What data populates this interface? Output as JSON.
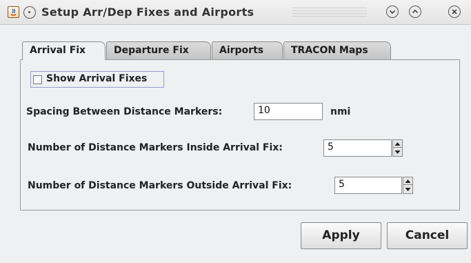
{
  "window": {
    "title": "Setup Arr/Dep Fixes and Airports"
  },
  "tabs": [
    {
      "label": "Arrival Fix",
      "active": true
    },
    {
      "label": "Departure Fix",
      "active": false
    },
    {
      "label": "Airports",
      "active": false
    },
    {
      "label": "TRACON Maps",
      "active": false
    }
  ],
  "arrival_fix": {
    "show_arrival_fixes": {
      "label": "Show Arrival Fixes",
      "checked": false
    },
    "spacing": {
      "label": "Spacing Between Distance Markers:",
      "value": "10",
      "unit": "nmi"
    },
    "inside": {
      "label": "Number of Distance Markers Inside Arrival Fix:",
      "value": "5"
    },
    "outside": {
      "label": "Number of Distance Markers Outside Arrival Fix:",
      "value": "5"
    }
  },
  "buttons": {
    "apply": "Apply",
    "cancel": "Cancel"
  },
  "icons": {
    "app": "java-app-icon",
    "menu": "window-menu-icon",
    "minimize": "minimize-icon",
    "maximize": "maximize-icon",
    "close": "close-icon"
  }
}
